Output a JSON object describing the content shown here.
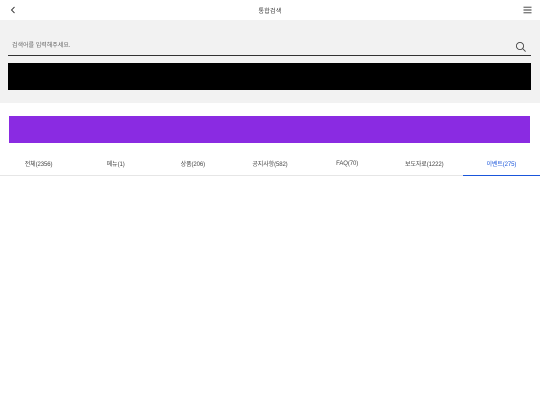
{
  "header": {
    "title": "통합검색",
    "back_icon": "chevron-left-icon",
    "menu_icon": "hamburger-menu-icon"
  },
  "search": {
    "placeholder": "검색어를 입력해주세요.",
    "icon": "search-icon"
  },
  "tabs": [
    {
      "label": "전체(2356)",
      "active": false
    },
    {
      "label": "메뉴(1)",
      "active": false
    },
    {
      "label": "상품(206)",
      "active": false
    },
    {
      "label": "공지사항(582)",
      "active": false
    },
    {
      "label": "FAQ(70)",
      "active": false
    },
    {
      "label": "보도자료(1222)",
      "active": false
    },
    {
      "label": "이벤트(275)",
      "active": true
    }
  ],
  "colors": {
    "accent": "#1a56db",
    "banner_black": "#000000",
    "banner_purple": "#8a2be2",
    "search_bg": "#f2f2f2"
  }
}
